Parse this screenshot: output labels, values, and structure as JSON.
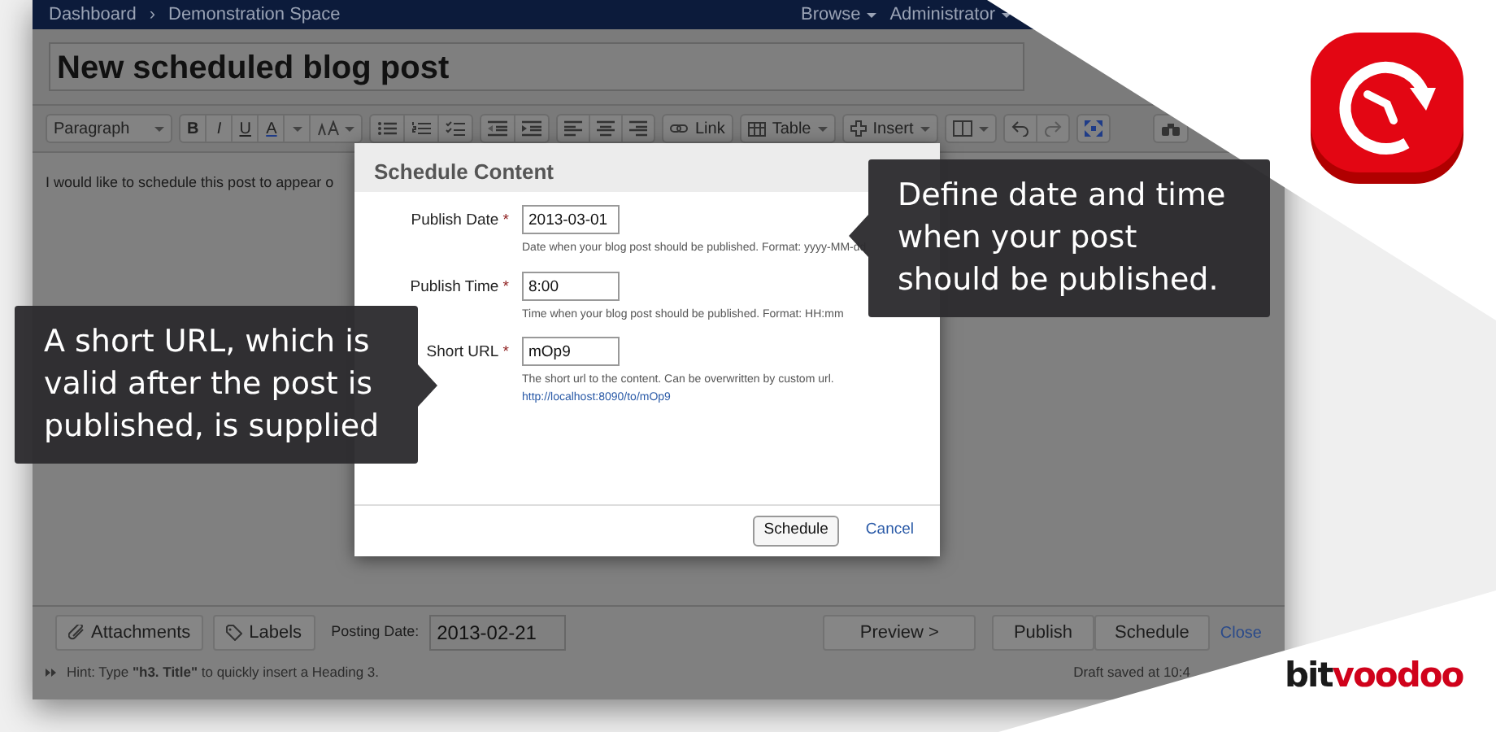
{
  "nav": {
    "breadcrumbs": [
      "Dashboard",
      "Demonstration Space"
    ],
    "separator": "›",
    "menus": [
      "Browse",
      "Administrator"
    ]
  },
  "title": "New scheduled blog post",
  "toolbar": {
    "style": "Paragraph",
    "format": [
      "B",
      "I",
      "U",
      "A"
    ],
    "link": "Link",
    "table": "Table",
    "insert": "Insert"
  },
  "body_text": "I would like to schedule this post to appear o",
  "dialog": {
    "title": "Schedule Content",
    "fields": [
      {
        "label": "Publish Date",
        "required_mark": "*",
        "value": "2013-03-01",
        "help": "Date when your blog post should be published. Format: yyyy-MM-dd"
      },
      {
        "label": "Publish Time",
        "required_mark": "*",
        "value": "8:00",
        "help": "Time when your blog post should be published. Format: HH:mm"
      },
      {
        "label": "Short URL",
        "required_mark": "*",
        "value": "mOp9",
        "help": "The short url to the content. Can be overwritten by custom url.",
        "link": "http://localhost:8090/to/mOp9"
      }
    ],
    "primary": "Schedule",
    "cancel": "Cancel"
  },
  "footer": {
    "attachments": "Attachments",
    "labels": "Labels",
    "posting_label": "Posting Date:",
    "posting_date": "2013-02-21",
    "preview": "Preview >",
    "publish": "Publish",
    "schedule": "Schedule",
    "close": "Close",
    "hint": "Hint: Type **\"h3. Title\"** to quickly insert a Heading 3.",
    "draft": "Draft saved at 10:4"
  },
  "callouts": [
    {
      "text": "Define date and time when your post should be published."
    },
    {
      "text": "A short URL, which is valid after the post is published, is supplied"
    }
  ],
  "brand": [
    "bit",
    "voodoo"
  ]
}
